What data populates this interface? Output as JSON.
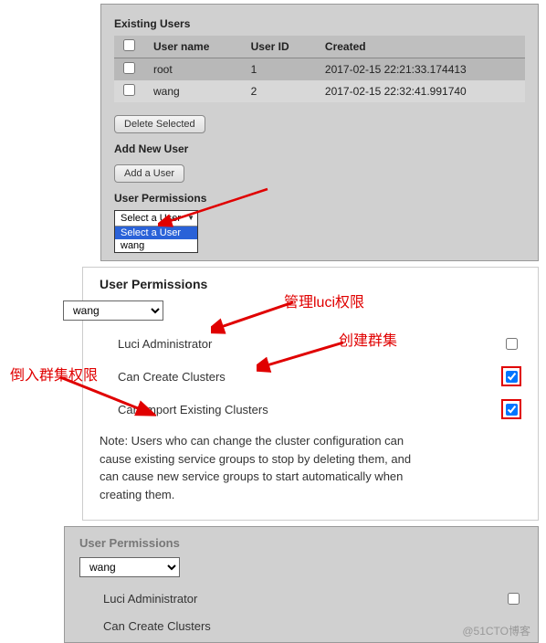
{
  "top": {
    "existing_users_title": "Existing Users",
    "columns": {
      "name": "User name",
      "id": "User ID",
      "created": "Created"
    },
    "rows": [
      {
        "name": "root",
        "id": "1",
        "created": "2017-02-15 22:21:33.174413"
      },
      {
        "name": "wang",
        "id": "2",
        "created": "2017-02-15 22:32:41.991740"
      }
    ],
    "delete_btn": "Delete Selected",
    "add_user_title": "Add New User",
    "add_btn": "Add a User",
    "perm_title": "User Permissions",
    "select_head": "Select a User",
    "options": {
      "opt1": "Select a User",
      "opt2": "wang"
    }
  },
  "mid": {
    "title": "User Permissions",
    "selected": "wang",
    "perm1": "Luci Administrator",
    "perm2": "Can Create Clusters",
    "perm3": "Can Import Existing Clusters",
    "note": "Note: Users who can change the cluster configuration can cause existing service groups to stop by deleting them, and can cause new service groups to start automatically when creating them."
  },
  "anno": {
    "a1": "管理luci权限",
    "a2": "创建群集",
    "a3": "倒入群集权限"
  },
  "bottom": {
    "title": "User Permissions",
    "selected": "wang",
    "perm1": "Luci Administrator",
    "perm2": "Can Create Clusters"
  },
  "watermark": "@51CTO博客"
}
